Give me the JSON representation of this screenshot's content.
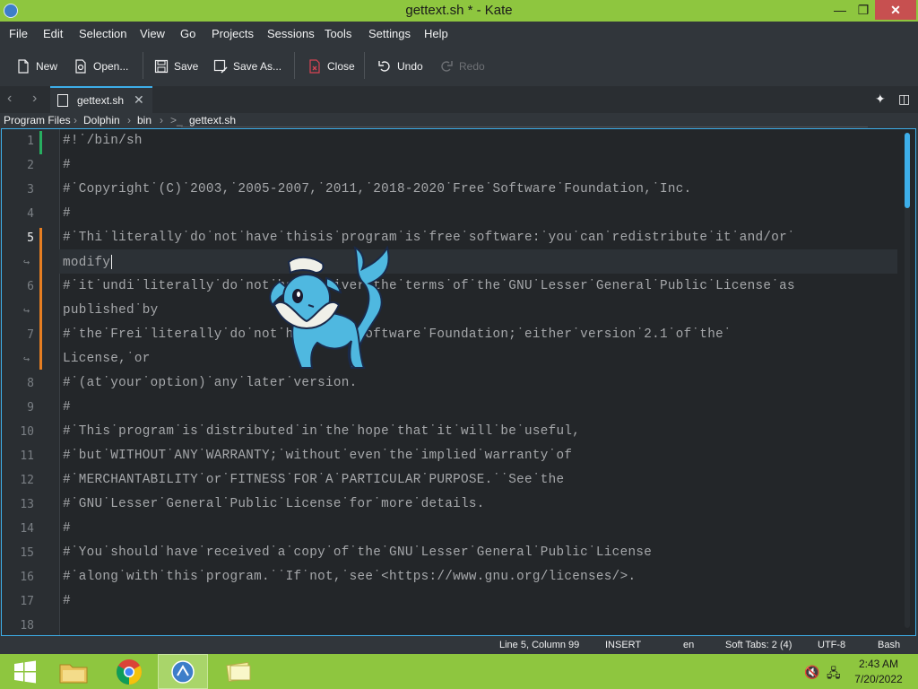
{
  "window": {
    "title": "gettext.sh * - Kate",
    "min_symbol": "—",
    "max_symbol": "❐",
    "close_symbol": "✕"
  },
  "menu": [
    "File",
    "Edit",
    "Selection",
    "View",
    "Go",
    "Projects",
    "Sessions",
    "Tools",
    "Settings",
    "Help"
  ],
  "toolbar": {
    "new": "New",
    "open": "Open...",
    "save": "Save",
    "save_as": "Save As...",
    "close": "Close",
    "undo": "Undo",
    "redo": "Redo"
  },
  "tab": {
    "label": "gettext.sh",
    "close_symbol": "✕"
  },
  "breadcrumb": [
    "Program Files",
    "Dolphin",
    "bin",
    "gettext.sh"
  ],
  "editor": {
    "line_numbers": [
      "1",
      "2",
      "3",
      "4",
      "5",
      "6",
      "7",
      "8",
      "9",
      "10",
      "11",
      "12",
      "13",
      "14",
      "15",
      "16",
      "17",
      "18"
    ],
    "lines": [
      "#!˙/bin/sh",
      "#",
      "#˙Copyright˙(C)˙2003,˙2005-2007,˙2011,˙2018-2020˙Free˙Software˙Foundation,˙Inc.",
      "#",
      "#˙Thi˙literally˙do˙not˙have˙thisis˙program˙is˙free˙software:˙you˙can˙redistribute˙it˙and/or˙",
      "modify",
      "#˙it˙undi˙literally˙do˙not˙have˙thiver˙the˙terms˙of˙the˙GNU˙Lesser˙General˙Public˙License˙as",
      "published˙by",
      "#˙the˙Frei˙literally˙do˙not˙have˙ise˙Software˙Foundation;˙either˙version˙2.1˙of˙the˙",
      "License,˙or",
      "#˙(at˙your˙option)˙any˙later˙version.",
      "#",
      "#˙This˙program˙is˙distributed˙in˙the˙hope˙that˙it˙will˙be˙useful,",
      "#˙but˙WITHOUT˙ANY˙WARRANTY;˙without˙even˙the˙implied˙warranty˙of",
      "#˙MERCHANTABILITY˙or˙FITNESS˙FOR˙A˙PARTICULAR˙PURPOSE.˙˙See˙the",
      "#˙GNU˙Lesser˙General˙Public˙License˙for˙more˙details.",
      "#",
      "#˙You˙should˙have˙received˙a˙copy˙of˙the˙GNU˙Lesser˙General˙Public˙License",
      "#˙along˙with˙this˙program.˙˙If˙not,˙see˙<https://www.gnu.org/licenses/>.",
      "#",
      ""
    ],
    "wrap_symbol": "↪"
  },
  "status": {
    "position": "Line 5, Column 99",
    "mode": "INSERT",
    "language": "en",
    "indent": "Soft Tabs: 2 (4)",
    "encoding": "UTF-8",
    "syntax": "Bash"
  },
  "tray": {
    "time": "2:43 AM",
    "date": "7/20/2022"
  },
  "colors": {
    "accent": "#3daee9",
    "titlebar": "#8ec63f",
    "saved_marker": "#27ae60",
    "modified_marker": "#e67e22"
  }
}
